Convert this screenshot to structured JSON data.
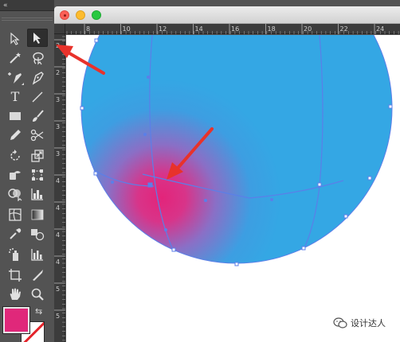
{
  "toolbar": {
    "collapse_glyph": "«",
    "tools": [
      {
        "name": "selection-tool",
        "icon": "arrow-outline-icon"
      },
      {
        "name": "direct-selection-tool",
        "icon": "arrow-solid-icon",
        "selected": true
      },
      {
        "name": "magic-wand-tool",
        "icon": "magic-wand-icon"
      },
      {
        "name": "lasso-tool",
        "icon": "lasso-icon"
      },
      {
        "name": "curvature-pen-tool",
        "icon": "pen-plus-icon"
      },
      {
        "name": "pen-tool",
        "icon": "pen-icon"
      },
      {
        "name": "type-tool",
        "icon": "type-icon",
        "glyph": "T"
      },
      {
        "name": "line-tool",
        "icon": "line-icon"
      },
      {
        "name": "rectangle-tool",
        "icon": "rectangle-icon"
      },
      {
        "name": "paintbrush-tool",
        "icon": "brush-icon"
      },
      {
        "name": "pencil-tool",
        "icon": "pencil-icon"
      },
      {
        "name": "scissors-tool",
        "icon": "scissors-icon"
      },
      {
        "name": "rotate-tool",
        "icon": "rotate-icon"
      },
      {
        "name": "scale-tool",
        "icon": "scale-icon"
      },
      {
        "name": "warp-tool",
        "icon": "warp-icon"
      },
      {
        "name": "free-transform-tool",
        "icon": "free-transform-icon"
      },
      {
        "name": "shape-builder-tool",
        "icon": "shape-builder-icon"
      },
      {
        "name": "graph-tool",
        "icon": "graph-icon"
      },
      {
        "name": "mesh-tool",
        "icon": "mesh-icon"
      },
      {
        "name": "gradient-tool",
        "icon": "gradient-icon"
      },
      {
        "name": "eyedropper-tool",
        "icon": "eyedropper-icon"
      },
      {
        "name": "blend-tool",
        "icon": "blend-icon"
      },
      {
        "name": "symbol-sprayer-tool",
        "icon": "symbol-sprayer-icon"
      },
      {
        "name": "column-graph-tool",
        "icon": "column-graph-icon"
      },
      {
        "name": "artboard-tool",
        "icon": "artboard-icon"
      },
      {
        "name": "slice-tool",
        "icon": "slice-icon"
      },
      {
        "name": "hand-tool",
        "icon": "hand-icon"
      },
      {
        "name": "zoom-tool",
        "icon": "zoom-icon"
      }
    ],
    "fill_color": "#e0287a",
    "stroke_color": "#ffffff",
    "swap_glyph": "⇆"
  },
  "window": {
    "controls": [
      "close",
      "minimize",
      "maximize"
    ]
  },
  "rulers": {
    "horizontal_labels": [
      "8",
      "10",
      "12",
      "14",
      "16",
      "18",
      "20",
      "22",
      "24"
    ],
    "vertical_labels": [
      "2",
      "2",
      "3",
      "3",
      "3",
      "4",
      "4",
      "4",
      "4",
      "5",
      "5"
    ]
  },
  "artwork": {
    "object": "gradient-mesh-sphere",
    "base_color": "#36a6e4",
    "highlight_color": "#e3247a",
    "mesh_line_color": "#5b7fe8",
    "annotation_arrow_color": "#e8322b"
  },
  "watermark": {
    "text": "设计达人"
  }
}
